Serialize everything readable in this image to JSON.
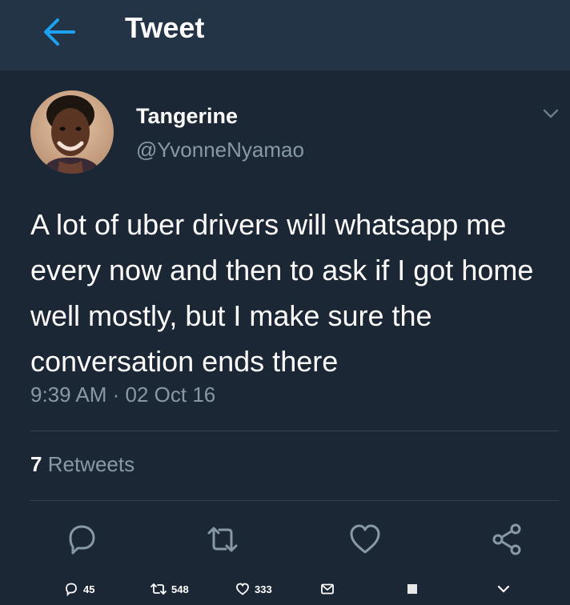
{
  "header": {
    "title": "Tweet",
    "back_icon": "back-arrow-icon",
    "accent": "#1da1f2"
  },
  "tweet": {
    "author": {
      "display_name": "Tangerine",
      "handle": "@YvonneNyamao"
    },
    "text": "A lot of uber drivers will whatsapp me every now and then to ask if I got home well mostly, but I make sure the conversation ends there",
    "timestamp": "9:39 AM · 02 Oct 16",
    "retweets": {
      "count": "7",
      "label": "Retweets"
    }
  },
  "actions": [
    {
      "name": "reply",
      "icon": "reply-icon"
    },
    {
      "name": "retweet",
      "icon": "retweet-icon"
    },
    {
      "name": "like",
      "icon": "heart-icon"
    },
    {
      "name": "share",
      "icon": "share-icon"
    }
  ],
  "bottom_bar": {
    "replies": "45",
    "retweets": "548",
    "likes": "333"
  },
  "colors": {
    "background": "#1c2735",
    "header_bg": "#243447",
    "muted_text": "#8899a6",
    "divider": "#38444d"
  }
}
